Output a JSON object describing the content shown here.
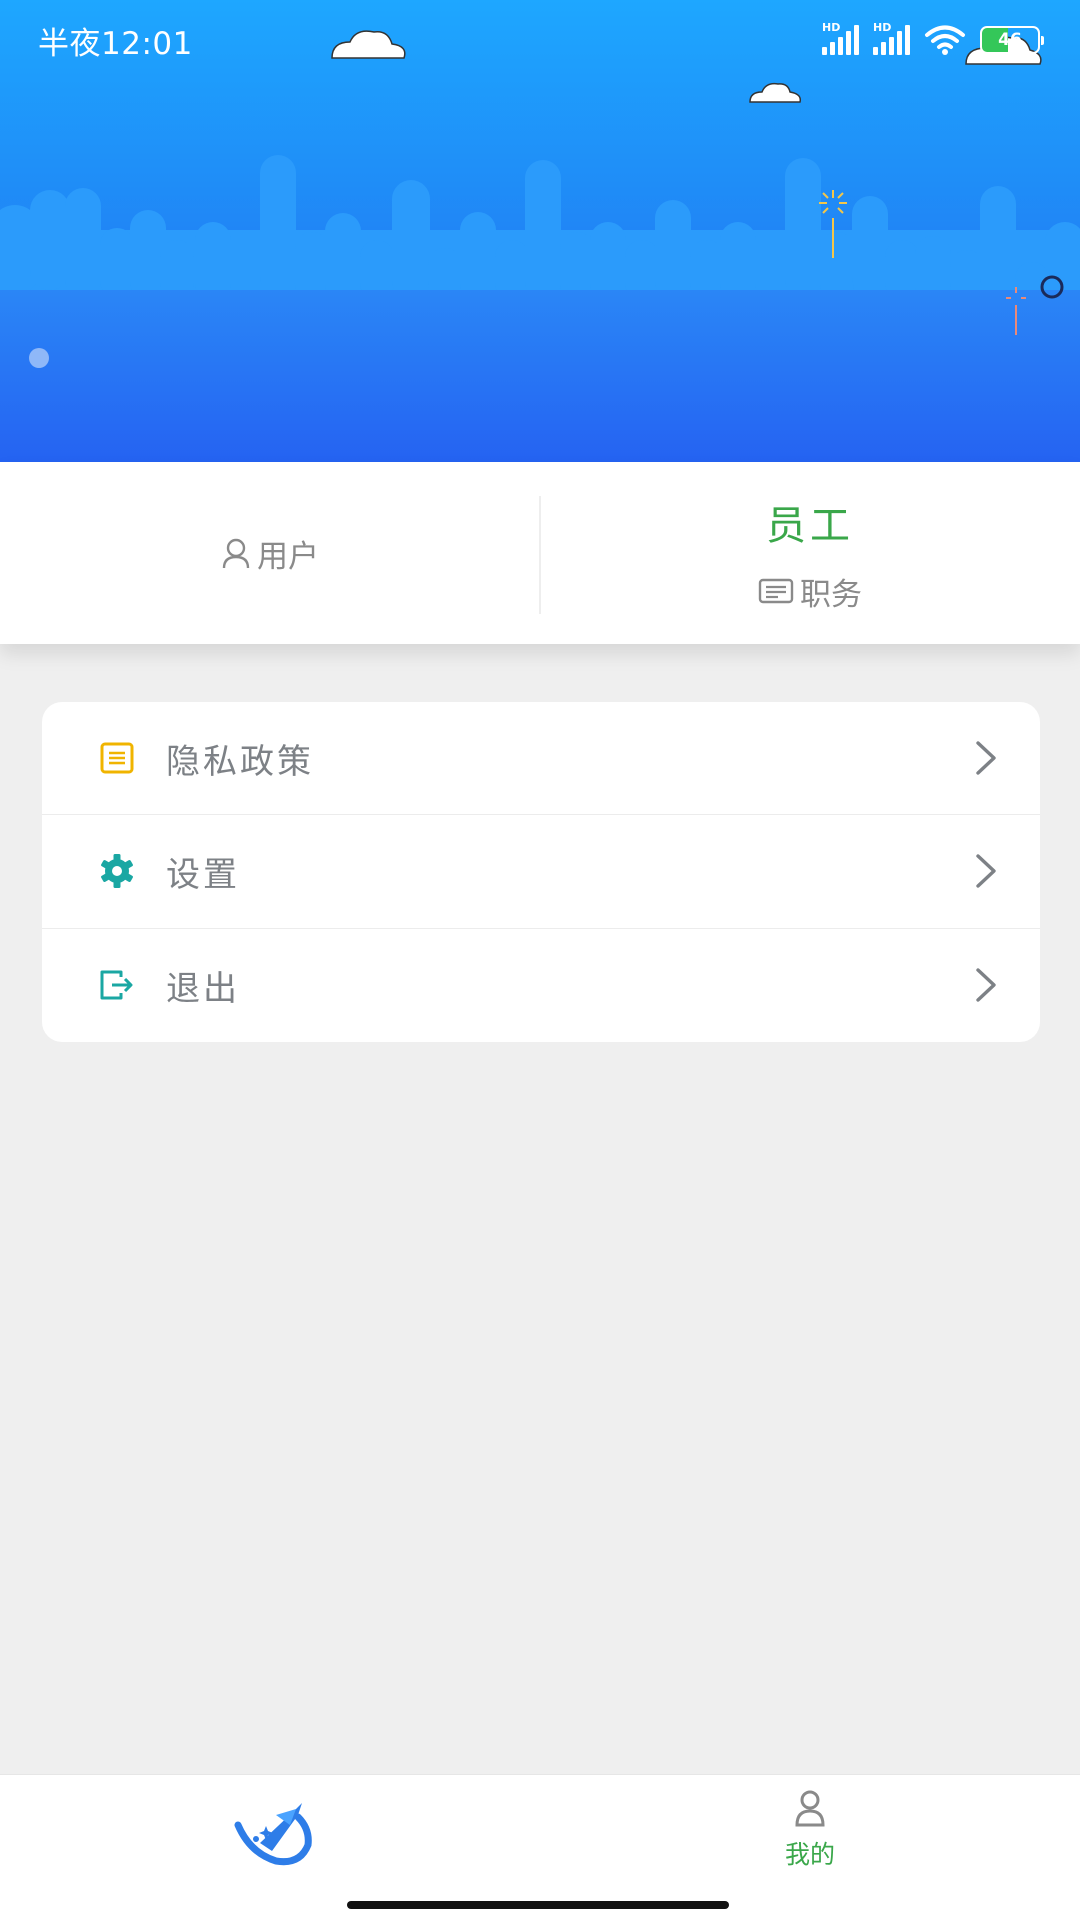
{
  "status_bar": {
    "time": "半夜12:01",
    "battery": "46"
  },
  "role_card": {
    "left_label": "用户",
    "right_name": "员工",
    "right_label": "职务"
  },
  "menu": {
    "items": [
      {
        "label": "隐私政策",
        "icon": "document-icon",
        "color": "#f0b400"
      },
      {
        "label": "设置",
        "icon": "gear-icon",
        "color": "#1aa7a3"
      },
      {
        "label": "退出",
        "icon": "logout-icon",
        "color": "#1aa7a3"
      }
    ]
  },
  "tabbar": {
    "mine_label": "我的"
  },
  "colors": {
    "accent_green": "#3aa74a",
    "banner_top": "#1ea7ff",
    "banner_bottom": "#2563f2"
  }
}
